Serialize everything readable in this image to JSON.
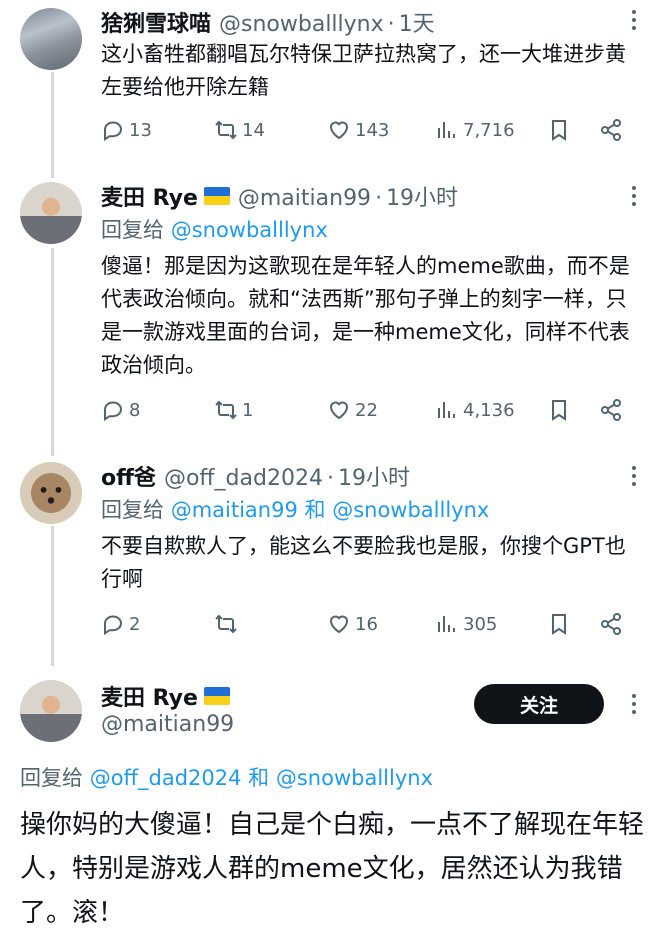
{
  "tweets": [
    {
      "name": "猞猁雪球喵",
      "handle": "@snowballlynx",
      "time": "1天",
      "text": "这小畜牲都翻唱瓦尔特保卫萨拉热窝了，还一大堆进步黄左要给他开除左籍",
      "replies": "13",
      "retweets": "14",
      "likes": "143",
      "views": "7,716"
    },
    {
      "name": "麦田 Rye",
      "handle": "@maitian99",
      "time": "19小时",
      "reply_prefix": "回复给",
      "reply_to": "@snowballlynx",
      "text": "傻逼！那是因为这歌现在是年轻人的meme歌曲，而不是代表政治倾向。就和“法西斯”那句子弹上的刻字一样，只是一款游戏里面的台词，是一种meme文化，同样不代表政治倾向。",
      "replies": "8",
      "retweets": "1",
      "likes": "22",
      "views": "4,136"
    },
    {
      "name": "off爸",
      "handle": "@off_dad2024",
      "time": "19小时",
      "reply_prefix": "回复给",
      "reply_to_1": "@maitian99",
      "reply_and": "和",
      "reply_to_2": "@snowballlynx",
      "text": "不要自欺欺人了，能这么不要脸我也是服，你搜个GPT也行啊",
      "replies": "2",
      "likes": "16",
      "views": "305"
    }
  ],
  "focus": {
    "name": "麦田 Rye",
    "handle": "@maitian99",
    "follow_label": "关注",
    "reply_prefix": "回复给",
    "reply_to_1": "@off_dad2024",
    "reply_and": "和",
    "reply_to_2": "@snowballlynx",
    "text": "操你妈的大傻逼！自己是个白痴，一点不了解现在年轻人，特别是游戏人群的meme文化，居然还认为我错了。滚！"
  },
  "colors": {
    "link": "#1d9bf0",
    "muted": "#536471",
    "text": "#0f1419",
    "thread": "#cfd9de"
  },
  "icons": [
    "reply-icon",
    "retweet-icon",
    "like-icon",
    "views-icon",
    "bookmark-icon",
    "share-icon",
    "more-icon",
    "ukraine-flag-icon"
  ]
}
